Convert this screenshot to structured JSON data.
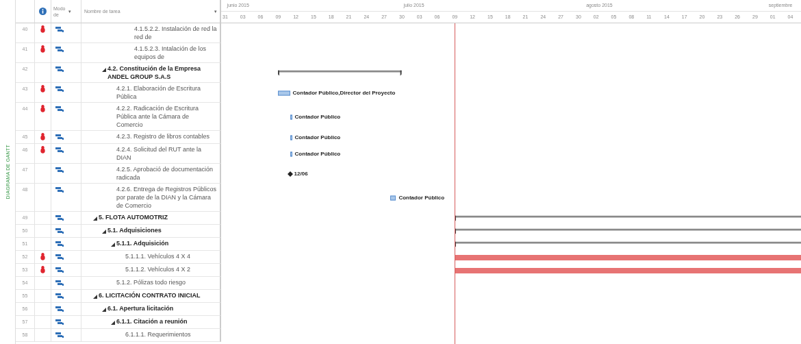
{
  "view_label": "DIAGRAMA DE GANTT",
  "columns": {
    "mode": "Modo de",
    "mode_menu": "▾",
    "name": "Nombre de tarea",
    "name_menu": "▾"
  },
  "timescale": {
    "months": [
      {
        "label": "junio 2015"
      },
      {
        "label": "julio 2015"
      },
      {
        "label": "agosto 2015"
      },
      {
        "label": "septiembre"
      }
    ],
    "ticks": [
      "31",
      "03",
      "06",
      "09",
      "12",
      "15",
      "18",
      "21",
      "24",
      "27",
      "30",
      "03",
      "06",
      "09",
      "12",
      "15",
      "18",
      "21",
      "24",
      "27",
      "30",
      "02",
      "05",
      "08",
      "11",
      "14",
      "17",
      "20",
      "23",
      "26",
      "29",
      "01",
      "04"
    ]
  },
  "rows": [
    {
      "id": "40",
      "flagged": true,
      "kind": "task",
      "name": "4.1.5.2.2. Instalación de red la red de"
    },
    {
      "id": "41",
      "flagged": true,
      "kind": "task",
      "name": "4.1.5.2.3. Intalación de los equipos de"
    },
    {
      "id": "42",
      "flagged": false,
      "kind": "summary",
      "expanded": true,
      "name": "4.2. Constitución de la Empresa ANDEL GROUP S.A.S",
      "bar": {
        "kind": "summary"
      }
    },
    {
      "id": "43",
      "flagged": true,
      "kind": "task",
      "name": "4.2.1. Elaboración de Escritura Pública",
      "bar": {
        "kind": "task",
        "label": "Contador Público,Director del Proyecto"
      }
    },
    {
      "id": "44",
      "flagged": true,
      "kind": "task",
      "name": "4.2.2. Radicación de Escritura Pública ante la Cámara de Comercio",
      "bar": {
        "kind": "task",
        "label": "Contador Público"
      }
    },
    {
      "id": "45",
      "flagged": true,
      "kind": "task",
      "name": "4.2.3. Registro de libros contables",
      "bar": {
        "kind": "task",
        "label": "Contador Público"
      }
    },
    {
      "id": "46",
      "flagged": true,
      "kind": "task",
      "name": "4.2.4. Solicitud del RUT ante la DIAN",
      "bar": {
        "kind": "task",
        "label": "Contador Público"
      }
    },
    {
      "id": "47",
      "flagged": false,
      "kind": "task",
      "name": "4.2.5. Aprobació de documentación radicada",
      "bar": {
        "kind": "milestone",
        "label": "12/06"
      }
    },
    {
      "id": "48",
      "flagged": false,
      "kind": "task",
      "name": "4.2.6. Entrega de Registros Públicos por parate de la DIAN y la Cámara de Comercio",
      "bar": {
        "kind": "task",
        "label": "Contador Público"
      }
    },
    {
      "id": "49",
      "flagged": false,
      "kind": "summary",
      "expanded": true,
      "name": "5. FLOTA AUTOMOTRIZ",
      "bar": {
        "kind": "summary"
      }
    },
    {
      "id": "50",
      "flagged": false,
      "kind": "summary",
      "expanded": true,
      "name": "5.1. Adquisiciones",
      "bar": {
        "kind": "summary"
      }
    },
    {
      "id": "51",
      "flagged": false,
      "kind": "summary",
      "expanded": true,
      "name": "5.1.1. Adquisición",
      "bar": {
        "kind": "summary"
      }
    },
    {
      "id": "52",
      "flagged": true,
      "kind": "task",
      "name": "5.1.1.1. Vehículos 4 X 4",
      "bar": {
        "kind": "critical"
      }
    },
    {
      "id": "53",
      "flagged": true,
      "kind": "task",
      "name": "5.1.1.2. Vehículos 4 X 2",
      "bar": {
        "kind": "critical"
      }
    },
    {
      "id": "54",
      "flagged": false,
      "kind": "task",
      "name": "5.1.2. Pólizas todo riesgo"
    },
    {
      "id": "55",
      "flagged": false,
      "kind": "summary",
      "expanded": true,
      "name": "6. LICITACIÓN CONTRATO INICIAL"
    },
    {
      "id": "56",
      "flagged": false,
      "kind": "summary",
      "expanded": true,
      "name": "6.1. Apertura licitación"
    },
    {
      "id": "57",
      "flagged": false,
      "kind": "summary",
      "expanded": true,
      "name": "6.1.1. Citación a reunión"
    },
    {
      "id": "58",
      "flagged": false,
      "kind": "task",
      "name": "6.1.1.1. Requerimientos"
    }
  ]
}
